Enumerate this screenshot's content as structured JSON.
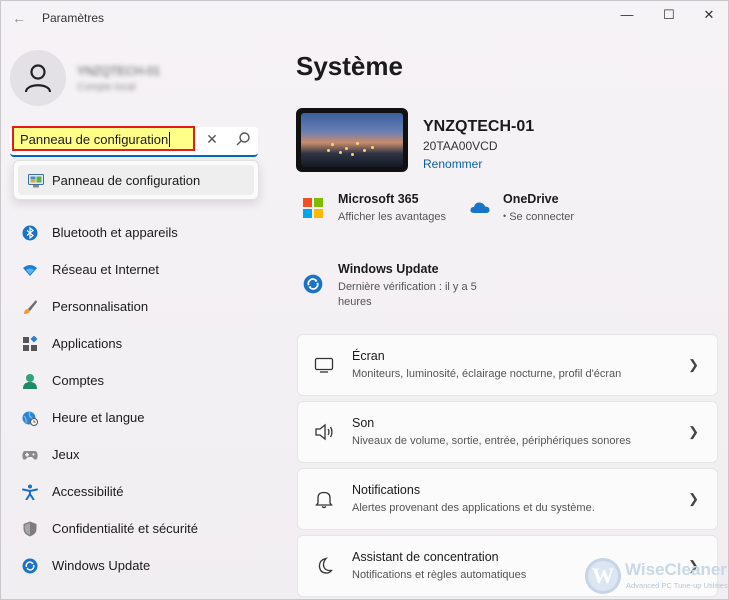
{
  "window": {
    "title": "Paramètres"
  },
  "user": {
    "name": "YNZQTECH-01",
    "subtitle": "Compte local"
  },
  "search": {
    "value": "Panneau de configuration"
  },
  "suggestions": [
    {
      "label": "Panneau de configuration",
      "icon": "control-panel-icon"
    }
  ],
  "nav": [
    {
      "label": "Bluetooth et appareils",
      "icon": "bluetooth-icon"
    },
    {
      "label": "Réseau et Internet",
      "icon": "wifi-icon"
    },
    {
      "label": "Personnalisation",
      "icon": "brush-icon"
    },
    {
      "label": "Applications",
      "icon": "apps-icon"
    },
    {
      "label": "Comptes",
      "icon": "person-icon"
    },
    {
      "label": "Heure et langue",
      "icon": "globe-clock-icon"
    },
    {
      "label": "Jeux",
      "icon": "gamepad-icon"
    },
    {
      "label": "Accessibilité",
      "icon": "accessibility-icon"
    },
    {
      "label": "Confidentialité et sécurité",
      "icon": "shield-icon"
    },
    {
      "label": "Windows Update",
      "icon": "update-icon"
    }
  ],
  "main": {
    "title": "Système",
    "device": {
      "name": "YNZQTECH-01",
      "model": "20TAA00VCD",
      "rename": "Renommer"
    },
    "tiles": [
      {
        "title": "Microsoft 365",
        "subtitle": "Afficher les avantages",
        "icon": "microsoft-logo-icon"
      },
      {
        "title": "OneDrive",
        "subtitle": "Se connecter",
        "icon": "onedrive-icon"
      },
      {
        "title": "Windows Update",
        "subtitle_line1": "Dernière vérification : il y a 5",
        "subtitle_line2": "heures",
        "icon": "update-icon"
      }
    ],
    "cards": [
      {
        "title": "Écran",
        "subtitle": "Moniteurs, luminosité, éclairage nocturne, profil d'écran",
        "icon": "monitor-icon"
      },
      {
        "title": "Son",
        "subtitle": "Niveaux de volume, sortie, entrée, périphériques sonores",
        "icon": "speaker-icon"
      },
      {
        "title": "Notifications",
        "subtitle": "Alertes provenant des applications et du système.",
        "icon": "bell-icon"
      },
      {
        "title": "Assistant de concentration",
        "subtitle": "Notifications et règles automatiques",
        "icon": "moon-icon"
      }
    ]
  },
  "watermark": {
    "letter": "W",
    "name": "WiseCleaner",
    "tagline": "Advanced PC Tune-up Utilities"
  },
  "colors": {
    "accent": "#0067c0",
    "highlight_border": "#e11c1c",
    "highlight_fill": "#ffff8a"
  }
}
